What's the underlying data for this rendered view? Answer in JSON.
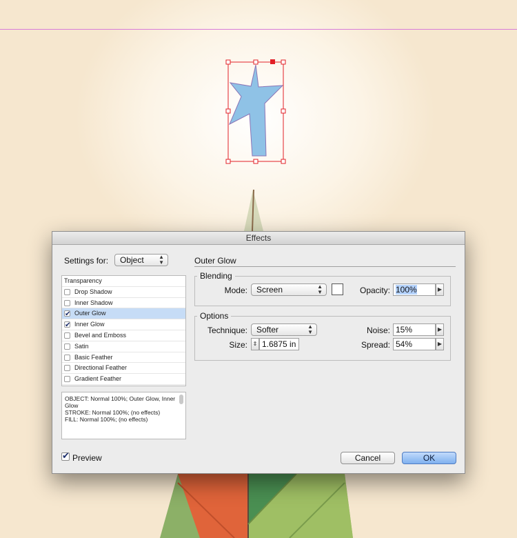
{
  "dialog": {
    "title": "Effects",
    "settings_for_label": "Settings for:",
    "settings_for_value": "Object",
    "section_title": "Outer Glow",
    "effects_list": [
      {
        "label": "Transparency",
        "checked": null,
        "active": false
      },
      {
        "label": "Drop Shadow",
        "checked": false,
        "active": false
      },
      {
        "label": "Inner Shadow",
        "checked": false,
        "active": false
      },
      {
        "label": "Outer Glow",
        "checked": true,
        "active": true
      },
      {
        "label": "Inner Glow",
        "checked": true,
        "active": false
      },
      {
        "label": "Bevel and Emboss",
        "checked": false,
        "active": false
      },
      {
        "label": "Satin",
        "checked": false,
        "active": false
      },
      {
        "label": "Basic Feather",
        "checked": false,
        "active": false
      },
      {
        "label": "Directional Feather",
        "checked": false,
        "active": false
      },
      {
        "label": "Gradient Feather",
        "checked": false,
        "active": false
      }
    ],
    "summary": {
      "line1": "OBJECT: Normal 100%; Outer Glow, Inner Glow",
      "line2": "STROKE: Normal 100%; (no effects)",
      "line3": "FILL: Normal 100%; (no effects)"
    },
    "blending": {
      "title": "Blending",
      "mode_label": "Mode:",
      "mode_value": "Screen",
      "swatch_color": "#ffffff",
      "opacity_label": "Opacity:",
      "opacity_value": "100%"
    },
    "options": {
      "title": "Options",
      "technique_label": "Technique:",
      "technique_value": "Softer",
      "noise_label": "Noise:",
      "noise_value": "15%",
      "size_label": "Size:",
      "size_value": "1.6875 in",
      "spread_label": "Spread:",
      "spread_value": "54%"
    },
    "preview_label": "Preview",
    "preview_checked": true,
    "cancel_label": "Cancel",
    "ok_label": "OK"
  },
  "colors": {
    "guide": "#d87ad8",
    "selection": "#e21f26",
    "star_fill": "#8fc2e6",
    "accent_button": "#7fb0ef"
  }
}
